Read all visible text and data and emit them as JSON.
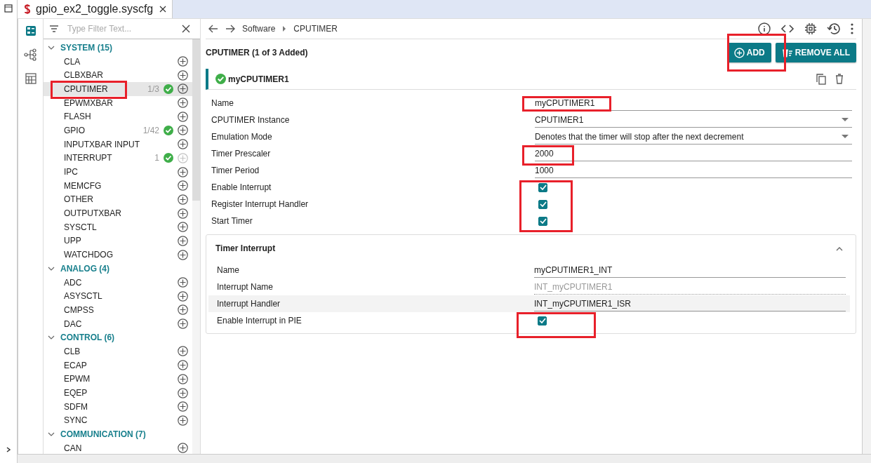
{
  "editor_tab": {
    "title": "gpio_ex2_toggle.syscfg"
  },
  "filter": {
    "placeholder": "Type Filter Text..."
  },
  "tree": [
    {
      "label": "SYSTEM (15)",
      "expanded": true,
      "children": [
        {
          "label": "CLA",
          "selected": false,
          "add_enabled": true
        },
        {
          "label": "CLBXBAR",
          "selected": false,
          "add_enabled": true
        },
        {
          "label": "CPUTIMER",
          "count": "1/3",
          "added": true,
          "selected": true,
          "add_enabled": true
        },
        {
          "label": "EPWMXBAR",
          "selected": false,
          "add_enabled": true
        },
        {
          "label": "FLASH",
          "selected": false,
          "add_enabled": true
        },
        {
          "label": "GPIO",
          "count": "1/42",
          "added": true,
          "selected": false,
          "add_enabled": true
        },
        {
          "label": "INPUTXBAR INPUT",
          "selected": false,
          "add_enabled": true
        },
        {
          "label": "INTERRUPT",
          "count": "1",
          "added": true,
          "selected": false,
          "add_enabled": false
        },
        {
          "label": "IPC",
          "selected": false,
          "add_enabled": true
        },
        {
          "label": "MEMCFG",
          "selected": false,
          "add_enabled": true
        },
        {
          "label": "OTHER",
          "selected": false,
          "add_enabled": true
        },
        {
          "label": "OUTPUTXBAR",
          "selected": false,
          "add_enabled": true
        },
        {
          "label": "SYSCTL",
          "selected": false,
          "add_enabled": true
        },
        {
          "label": "UPP",
          "selected": false,
          "add_enabled": true
        },
        {
          "label": "WATCHDOG",
          "selected": false,
          "add_enabled": true
        }
      ]
    },
    {
      "label": "ANALOG (4)",
      "expanded": true,
      "children": [
        {
          "label": "ADC",
          "selected": false,
          "add_enabled": true
        },
        {
          "label": "ASYSCTL",
          "selected": false,
          "add_enabled": true
        },
        {
          "label": "CMPSS",
          "selected": false,
          "add_enabled": true
        },
        {
          "label": "DAC",
          "selected": false,
          "add_enabled": true
        }
      ]
    },
    {
      "label": "CONTROL (6)",
      "expanded": true,
      "children": [
        {
          "label": "CLB",
          "selected": false,
          "add_enabled": true
        },
        {
          "label": "ECAP",
          "selected": false,
          "add_enabled": true
        },
        {
          "label": "EPWM",
          "selected": false,
          "add_enabled": true
        },
        {
          "label": "EQEP",
          "selected": false,
          "add_enabled": true
        },
        {
          "label": "SDFM",
          "selected": false,
          "add_enabled": true
        },
        {
          "label": "SYNC",
          "selected": false,
          "add_enabled": true
        }
      ]
    },
    {
      "label": "COMMUNICATION (7)",
      "expanded": true,
      "children": [
        {
          "label": "CAN",
          "selected": false,
          "add_enabled": true
        }
      ]
    }
  ],
  "breadcrumb": [
    "Software",
    "CPUTIMER"
  ],
  "module": {
    "title": "CPUTIMER (1 of 3 Added)",
    "buttons": [
      {
        "label": "ADD",
        "kind": "add"
      },
      {
        "label": "REMOVE ALL",
        "kind": "remove"
      }
    ]
  },
  "instance": {
    "name": "myCPUTIMER1",
    "valid": true
  },
  "fields": [
    {
      "label": "Name",
      "kind": "text",
      "value": "myCPUTIMER1"
    },
    {
      "label": "CPUTIMER Instance",
      "kind": "select",
      "value": "CPUTIMER1"
    },
    {
      "label": "Emulation Mode",
      "kind": "select",
      "value": "Denotes that the timer will stop after the next decrement"
    },
    {
      "label": "Timer Prescaler",
      "kind": "text",
      "value": "2000"
    },
    {
      "label": "Timer Period",
      "kind": "text",
      "value": "1000"
    },
    {
      "label": "Enable Interrupt",
      "kind": "checkbox",
      "checked": true
    },
    {
      "label": "Register Interrupt Handler",
      "kind": "checkbox",
      "checked": true
    },
    {
      "label": "Start Timer",
      "kind": "checkbox",
      "checked": true
    }
  ],
  "subsection": {
    "title": "Timer Interrupt",
    "expanded": true,
    "fields": [
      {
        "label": "Name",
        "kind": "text",
        "value": "myCPUTIMER1_INT",
        "shaded": false
      },
      {
        "label": "Interrupt Name",
        "kind": "readonly",
        "value": "INT_myCPUTIMER1",
        "shaded": false
      },
      {
        "label": "Interrupt Handler",
        "kind": "text",
        "value": "INT_myCPUTIMER1_ISR",
        "shaded": true
      },
      {
        "label": "Enable Interrupt in PIE",
        "kind": "checkbox",
        "checked": true,
        "shaded": false
      }
    ]
  }
}
